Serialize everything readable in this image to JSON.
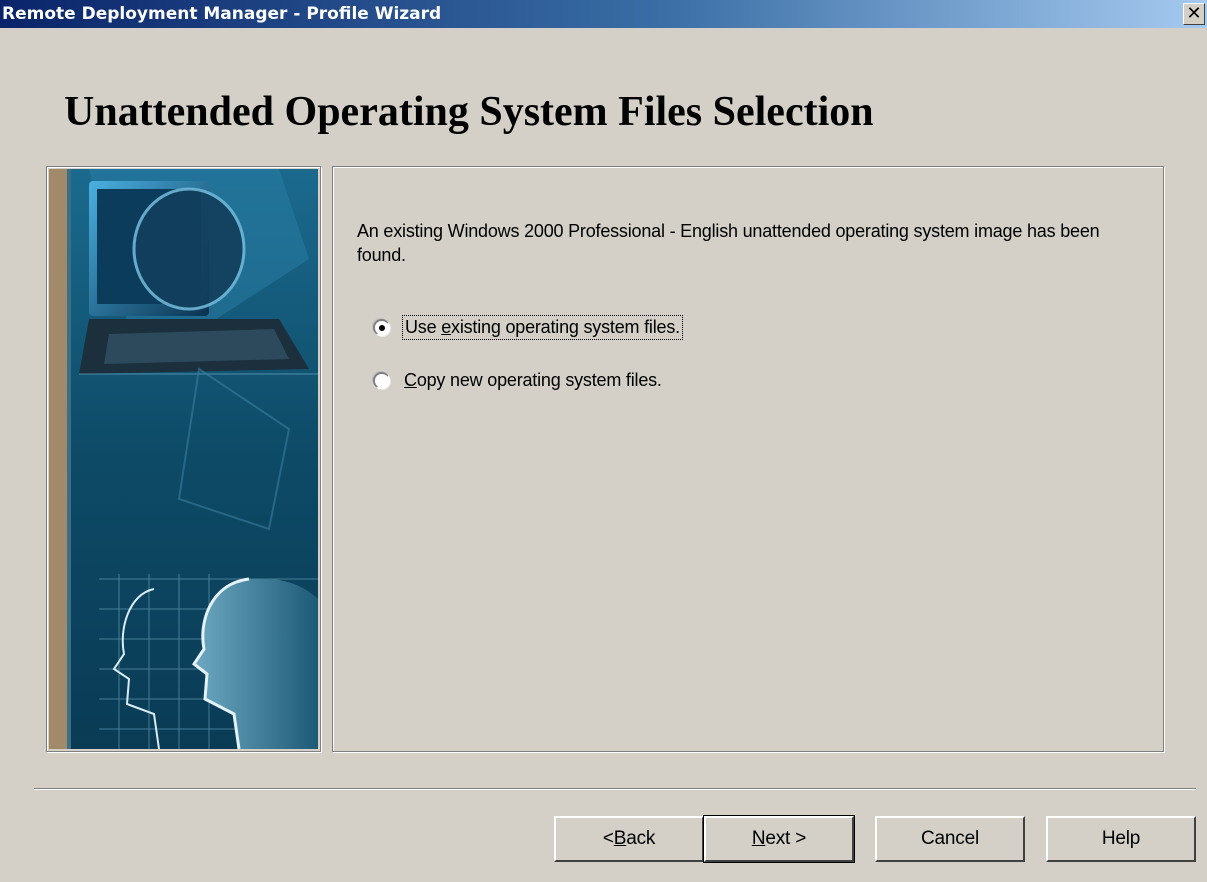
{
  "window": {
    "title": "Remote Deployment Manager - Profile Wizard",
    "close_glyph": "✕"
  },
  "page": {
    "title": "Unattended Operating System Files Selection"
  },
  "content": {
    "description": "An existing Windows 2000 Professional - English  unattended operating system image has been found.",
    "options": [
      {
        "label_pre": "Use ",
        "label_key": "e",
        "label_post": "xisting operating system files.",
        "selected": true,
        "focused": true
      },
      {
        "label_pre": "",
        "label_key": "C",
        "label_post": "opy new operating system files.",
        "selected": false,
        "focused": false
      }
    ]
  },
  "buttons": {
    "back": {
      "pre": "< ",
      "key": "B",
      "post": "ack"
    },
    "next": {
      "pre": "",
      "key": "N",
      "post": "ext >"
    },
    "cancel": "Cancel",
    "help": "Help"
  },
  "colors": {
    "face": "#d4d0c8",
    "title_start": "#0a246a",
    "title_end": "#a6caf0",
    "art_teal": "#0d4a66"
  },
  "icons": [
    "close-icon",
    "radio-selected-icon",
    "radio-unselected-icon"
  ]
}
